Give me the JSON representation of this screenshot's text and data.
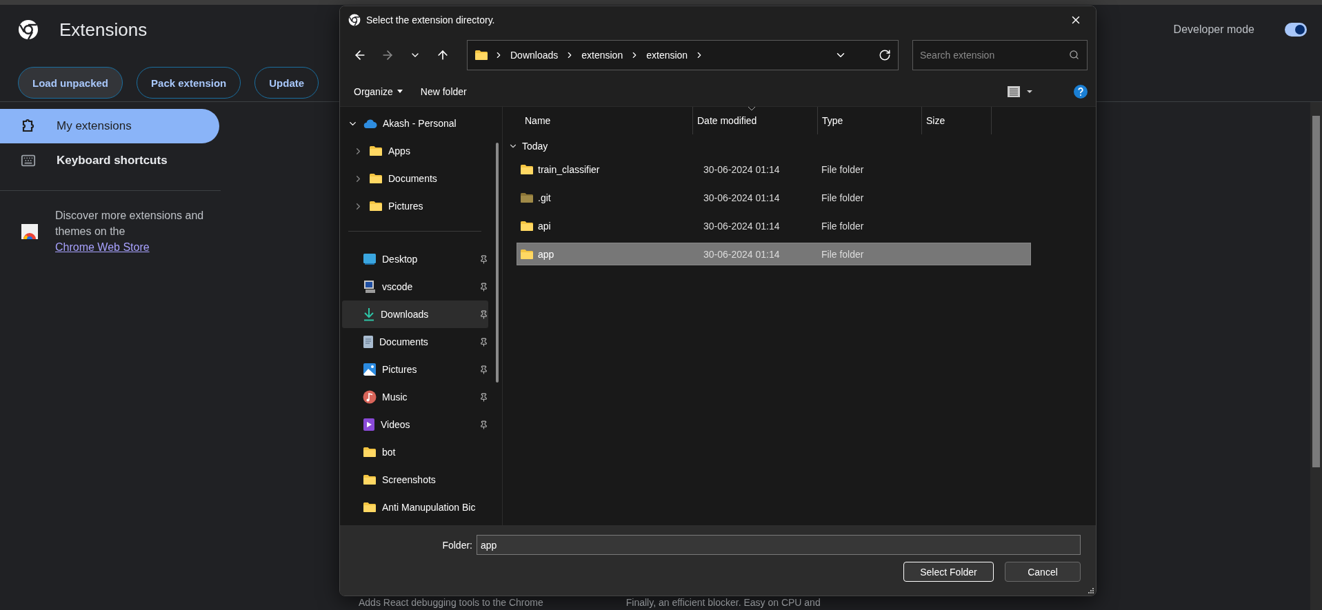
{
  "page": {
    "title": "Extensions",
    "developer_mode": {
      "label": "Developer mode",
      "on": true
    },
    "actions": [
      {
        "label": "Load unpacked",
        "focused": true
      },
      {
        "label": "Pack extension",
        "focused": false
      },
      {
        "label": "Update",
        "focused": false
      }
    ],
    "sidebar": {
      "items": [
        {
          "label": "My extensions",
          "kind": "puzzle",
          "selected": true
        },
        {
          "label": "Keyboard shortcuts",
          "kind": "keyboard",
          "selected": false
        }
      ],
      "promo": {
        "text": "Discover more extensions and themes on the ",
        "link": "Chrome Web Store"
      }
    },
    "cards": [
      {
        "description": "Adds React debugging tools to the Chrome"
      },
      {
        "description": "Finally, an efficient blocker. Easy on CPU and"
      }
    ]
  },
  "dialog": {
    "title": "Select the extension directory.",
    "breadcrumb": [
      "Downloads",
      "extension",
      "extension"
    ],
    "search": {
      "placeholder": "Search extension"
    },
    "toolbar": {
      "organize": "Organize",
      "new_folder": "New folder"
    },
    "nav": {
      "tree": [
        {
          "label": "Akash - Personal",
          "expanded": true,
          "children": [
            {
              "label": "Apps",
              "expanded": false
            },
            {
              "label": "Documents",
              "expanded": false
            },
            {
              "label": "Pictures",
              "expanded": false
            }
          ]
        }
      ],
      "quick_access": [
        {
          "label": "Desktop",
          "kind": "desktop",
          "pinned": true,
          "selected": false
        },
        {
          "label": "vscode",
          "kind": "computer",
          "pinned": true,
          "selected": false
        },
        {
          "label": "Downloads",
          "kind": "download",
          "pinned": true,
          "selected": true
        },
        {
          "label": "Documents",
          "kind": "document",
          "pinned": true,
          "selected": false
        },
        {
          "label": "Pictures",
          "kind": "picture",
          "pinned": true,
          "selected": false
        },
        {
          "label": "Music",
          "kind": "music",
          "pinned": true,
          "selected": false
        },
        {
          "label": "Videos",
          "kind": "video",
          "pinned": true,
          "selected": false
        },
        {
          "label": "bot",
          "kind": "folder",
          "pinned": false,
          "selected": false
        },
        {
          "label": "Screenshots",
          "kind": "folder",
          "pinned": false,
          "selected": false
        },
        {
          "label": "Anti Manupulation Bic",
          "kind": "folder",
          "pinned": false,
          "selected": false
        }
      ]
    },
    "columns": [
      "Name",
      "Date modified",
      "Type",
      "Size"
    ],
    "group": {
      "label": "Today",
      "expanded": true
    },
    "rows": [
      {
        "name": "train_classifier",
        "date": "30-06-2024 01:14",
        "type": "File folder",
        "hidden": false,
        "selected": false
      },
      {
        "name": ".git",
        "date": "30-06-2024 01:14",
        "type": "File folder",
        "hidden": true,
        "selected": false
      },
      {
        "name": "api",
        "date": "30-06-2024 01:14",
        "type": "File folder",
        "hidden": false,
        "selected": false
      },
      {
        "name": "app",
        "date": "30-06-2024 01:14",
        "type": "File folder",
        "hidden": false,
        "selected": true
      }
    ],
    "footer": {
      "folder_label": "Folder:",
      "folder_value": "app",
      "buttons": [
        {
          "label": "Select Folder",
          "default": true
        },
        {
          "label": "Cancel",
          "default": false
        }
      ]
    }
  }
}
